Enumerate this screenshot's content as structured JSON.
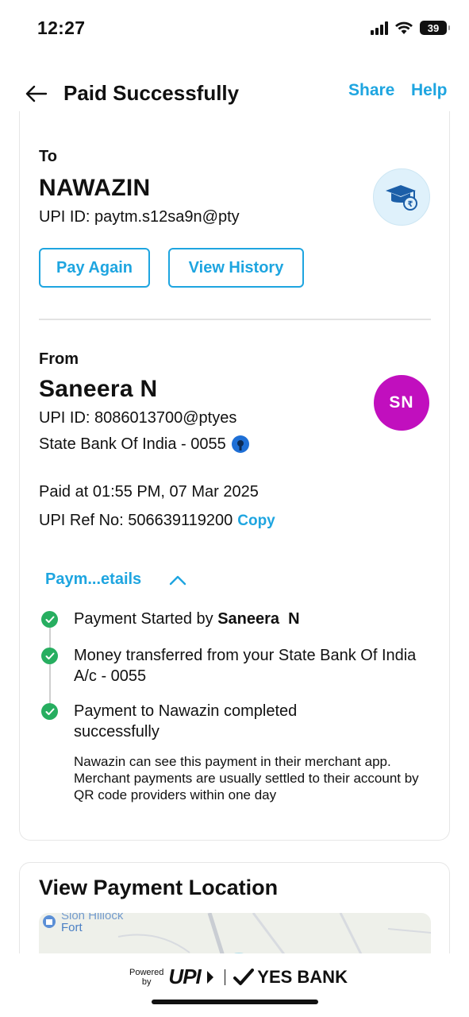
{
  "status_bar": {
    "time": "12:27",
    "battery": "39"
  },
  "header": {
    "title": "Paid Successfully",
    "share_label": "Share",
    "help_label": "Help"
  },
  "to": {
    "label": "To",
    "name": "NAWAZIN",
    "upi_id": "UPI ID: paytm.s12sa9n@pty",
    "avatar_icon": "graduation-cap-rupee-icon",
    "pay_again_label": "Pay Again",
    "view_history_label": "View History"
  },
  "from": {
    "label": "From",
    "name": "Saneera N",
    "initials": "SN",
    "upi_id": "UPI ID: 8086013700@ptyes",
    "bank": "State Bank Of India - 0055",
    "paid_at": "Paid at 01:55 PM, 07 Mar 2025",
    "upi_ref": "UPI Ref No: 506639119200",
    "copy_label": "Copy"
  },
  "details": {
    "toggle_label": "Paym...etails",
    "steps": [
      {
        "prefix": "Payment Started by ",
        "bold": "Saneera  N"
      },
      {
        "text": "Money transferred from your State Bank Of India A/c - 0055"
      },
      {
        "text": "Payment to Nawazin completed successfully"
      }
    ],
    "note": "Nawazin can see this payment in their merchant app. Merchant payments are usually settled to their account by QR code providers within one day"
  },
  "location": {
    "title": "View Payment Location",
    "map_label_1": "Sion Hillock",
    "map_label_2": "Fort"
  },
  "footer": {
    "powered": "Powered",
    "by": "by",
    "upi": "UPI",
    "bank": "YES BANK"
  },
  "colors": {
    "accent": "#1ea5e0",
    "avatar_sn": "#c10fbe",
    "success": "#27ae60"
  }
}
